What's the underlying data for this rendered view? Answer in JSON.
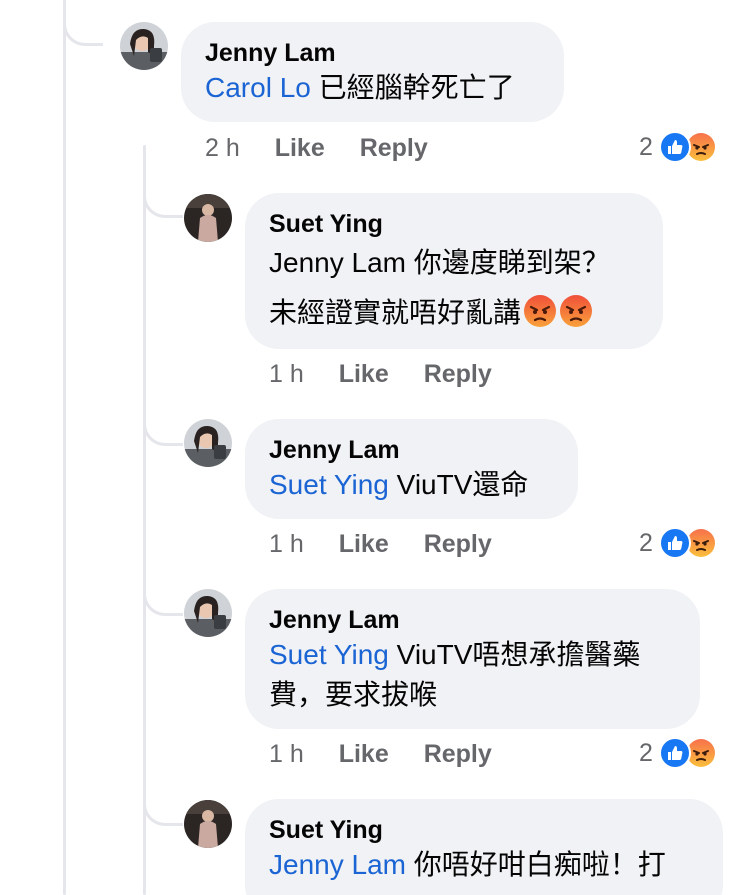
{
  "comments": [
    {
      "author": "Jenny Lam",
      "mention": "Carol Lo",
      "text": " 已經腦幹死亡了",
      "time": "2 h",
      "like_label": "Like",
      "reply_label": "Reply",
      "reaction_count": "2"
    },
    {
      "author": "Suet Ying",
      "mention": "Jenny Lam",
      "text": " 你邊度睇到架？",
      "text2": "未經證實就唔好亂講",
      "time": "1 h",
      "like_label": "Like",
      "reply_label": "Reply"
    },
    {
      "author": "Jenny Lam",
      "mention": "Suet Ying",
      "text": " ViuTV還命",
      "time": "1 h",
      "like_label": "Like",
      "reply_label": "Reply",
      "reaction_count": "2"
    },
    {
      "author": "Jenny Lam",
      "mention": "Suet Ying",
      "text": " ViuTV唔想承擔醫藥",
      "text2": "費，要求拔喉",
      "time": "1 h",
      "like_label": "Like",
      "reply_label": "Reply",
      "reaction_count": "2"
    },
    {
      "author": "Suet Ying",
      "mention": "Jenny Lam",
      "text": " 你唔好咁白痴啦！打"
    }
  ],
  "colors": {
    "mention": "#1b64d4",
    "like": "#1877f2",
    "angry_top": "#f7714b",
    "bubble": "#f0f2f5"
  }
}
